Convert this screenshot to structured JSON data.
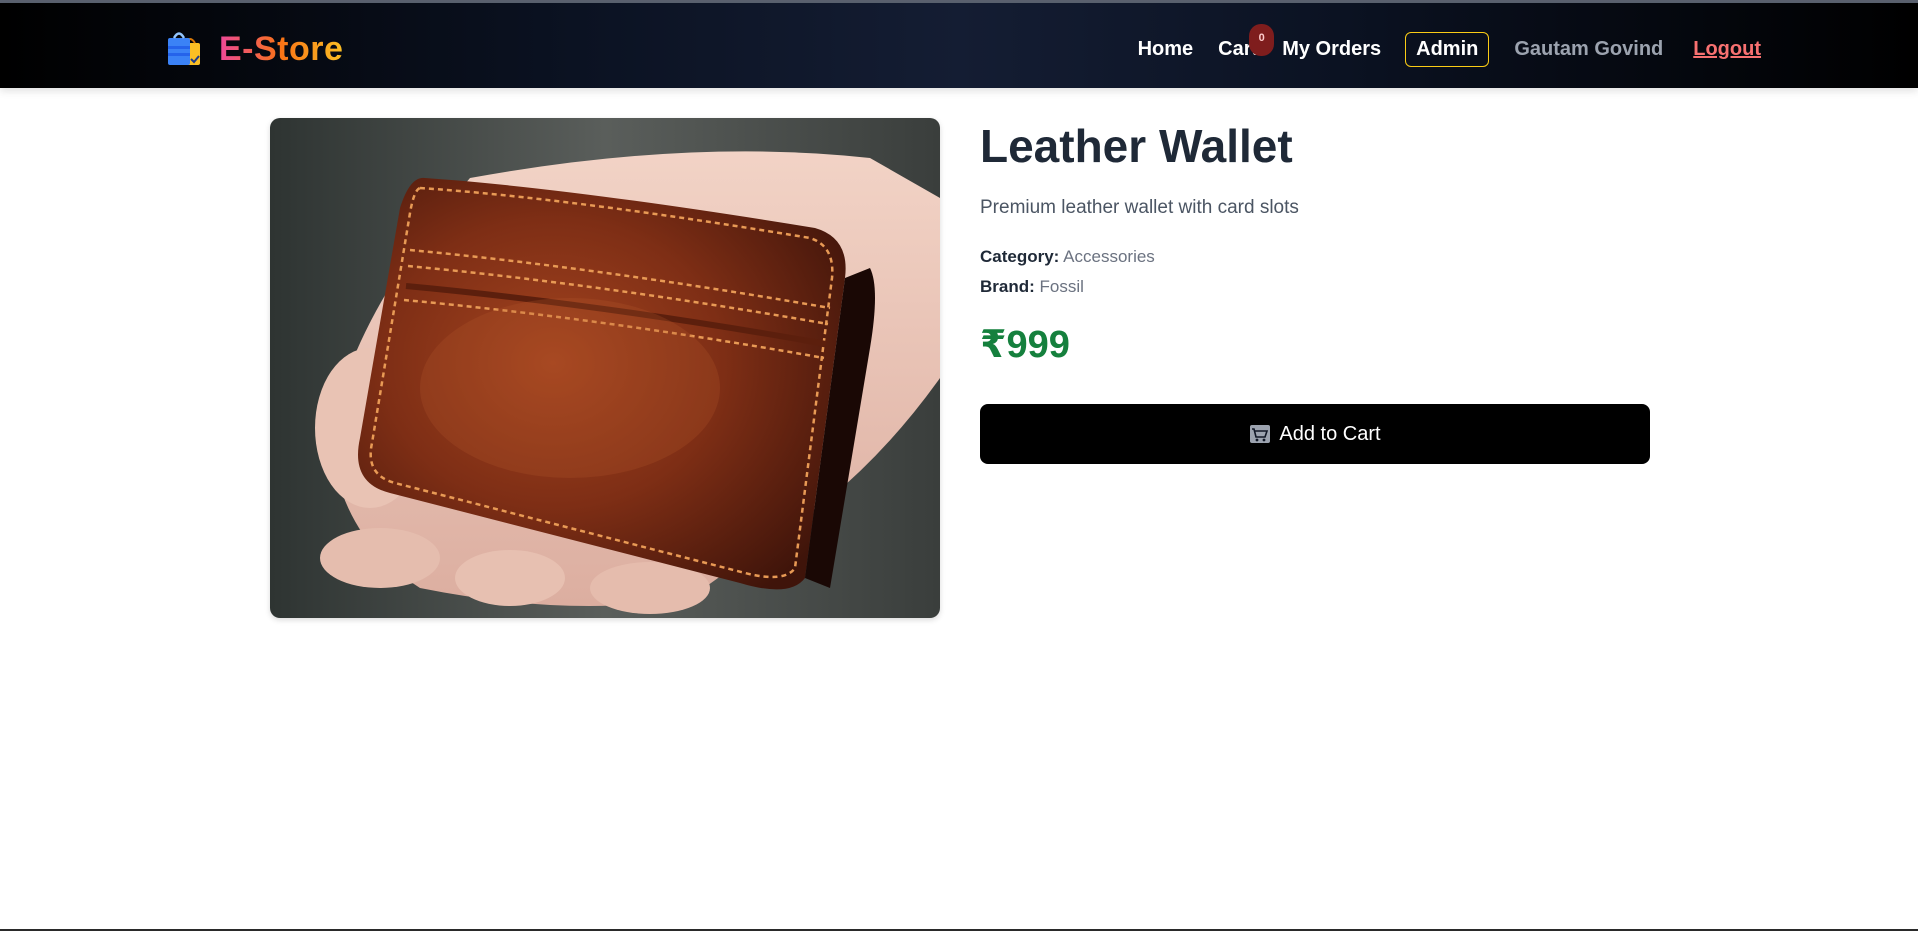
{
  "navbar": {
    "brand_icon": "shopping-bags-icon",
    "brand_name": "E-Store",
    "links": {
      "home": "Home",
      "cart": "Cart",
      "cart_count": "0",
      "orders": "My Orders",
      "admin": "Admin",
      "user": "Gautam Govind",
      "logout": "Logout"
    }
  },
  "product": {
    "image_alt": "Leather Wallet",
    "title": "Leather Wallet",
    "description": "Premium leather wallet with card slots",
    "category_label": "Category:",
    "category": "Accessories",
    "brand_label": "Brand:",
    "brand": "Fossil",
    "price": "₹999",
    "add_to_cart": "Add to Cart",
    "add_icon": "shopping-cart-icon"
  },
  "colors": {
    "price": "#15803d",
    "admin_border": "#facc15",
    "logout": "#f87171",
    "button": "#000000"
  }
}
